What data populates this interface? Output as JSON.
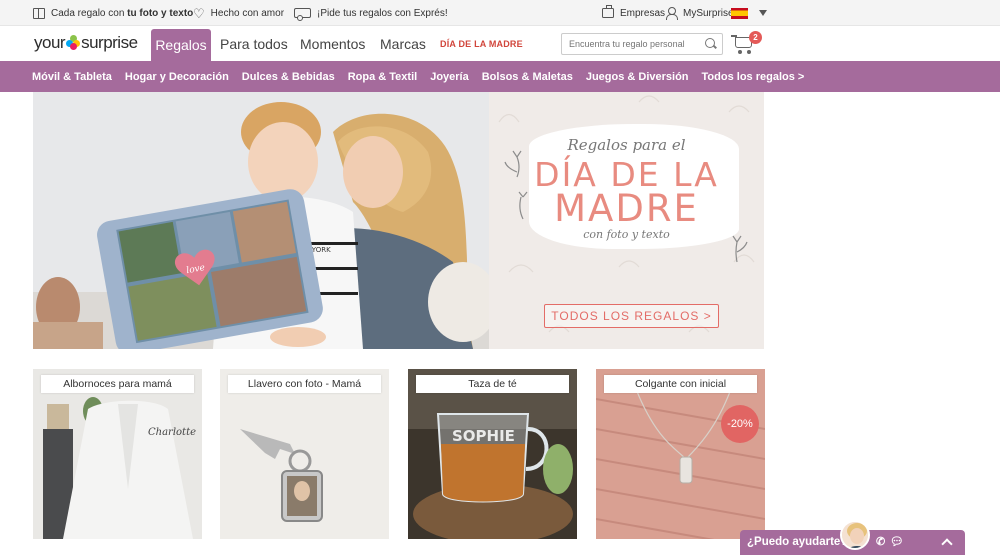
{
  "topbar": {
    "usp1_prefix": "Cada regalo con ",
    "usp1_bold": "tu foto y texto",
    "usp2": "Hecho con amor",
    "usp3": "¡Pide tus regalos con Exprés!",
    "empresas": "Empresas",
    "account": "MySurprise",
    "icons": [
      "gift-icon",
      "heart-icon",
      "truck-icon",
      "briefcase-icon",
      "user-icon",
      "flag-es-icon",
      "caret-down-icon"
    ]
  },
  "header": {
    "logo_left": "your",
    "logo_right": "surprise",
    "nav": {
      "regalos": "Regalos",
      "para_todos": "Para todos",
      "momentos": "Momentos",
      "marcas": "Marcas",
      "dia_madre": "DÍA DE LA MADRE"
    },
    "search_placeholder": "Encuentra tu regalo personal",
    "cart_count": "2"
  },
  "categories": [
    "Móvil & Tableta",
    "Hogar y Decoración",
    "Dulces & Bebidas",
    "Ropa & Textil",
    "Joyería",
    "Bolsos & Maletas",
    "Juegos & Diversión",
    "Todos los regalos >"
  ],
  "hero": {
    "script_top": "Regalos para el",
    "line1": "DÍA DE LA",
    "line2": "MADRE",
    "script_bottom": "con foto y texto",
    "cta": "TODOS LOS REGALOS  >",
    "pillow_heart": "love",
    "shirt_text": "NEW YORK"
  },
  "tiles": [
    {
      "label": "Albornoces para mamá",
      "embroidery": "Charlotte"
    },
    {
      "label": "Llavero con foto - Mamá"
    },
    {
      "label": "Taza de té",
      "mug_text": "SOPHIE"
    },
    {
      "label": "Colgante con inicial",
      "badge": "-20%"
    }
  ],
  "help": {
    "label": "¿Puedo ayudarte?"
  },
  "colors": {
    "brand_purple": "#a56b9c",
    "accent_red": "#d1453b",
    "hero_pink": "#e88b80"
  }
}
